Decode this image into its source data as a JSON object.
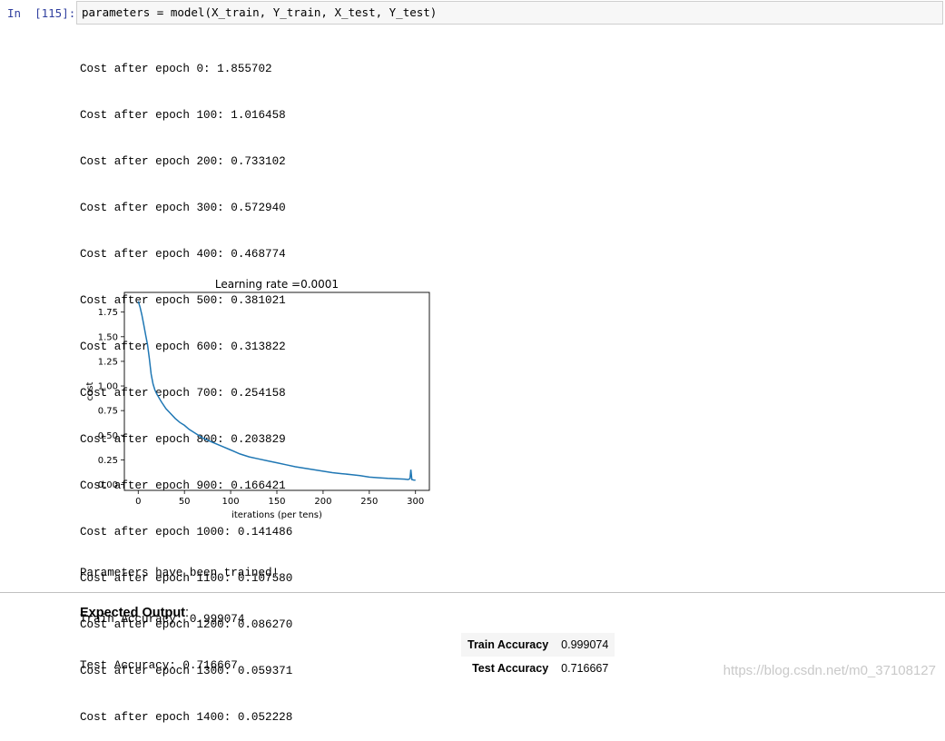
{
  "cell": {
    "prompt": "In  [115]:",
    "code": "parameters = model(X_train, Y_train, X_test, Y_test)"
  },
  "output_lines": [
    "Cost after epoch 0: 1.855702",
    "Cost after epoch 100: 1.016458",
    "Cost after epoch 200: 0.733102",
    "Cost after epoch 300: 0.572940",
    "Cost after epoch 400: 0.468774",
    "Cost after epoch 500: 0.381021",
    "Cost after epoch 600: 0.313822",
    "Cost after epoch 700: 0.254158",
    "Cost after epoch 800: 0.203829",
    "Cost after epoch 900: 0.166421",
    "Cost after epoch 1000: 0.141486",
    "Cost after epoch 1100: 0.107580",
    "Cost after epoch 1200: 0.086270",
    "Cost after epoch 1300: 0.059371",
    "Cost after epoch 1400: 0.052228"
  ],
  "chart_data": {
    "type": "line",
    "title": "Learning rate =0.0001",
    "xlabel": "iterations (per tens)",
    "ylabel": "cost",
    "xlim": [
      -15,
      315
    ],
    "ylim": [
      -0.06,
      1.95
    ],
    "xticks": [
      0,
      50,
      100,
      150,
      200,
      250,
      300
    ],
    "yticks": [
      0.0,
      0.25,
      0.5,
      0.75,
      1.0,
      1.25,
      1.5,
      1.75
    ],
    "ytick_labels": [
      "0.00",
      "0.25",
      "0.50",
      "0.75",
      "1.00",
      "1.25",
      "1.50",
      "1.75"
    ],
    "color": "#1f77b4",
    "x": [
      0,
      2,
      4,
      6,
      8,
      10,
      12,
      14,
      16,
      18,
      20,
      25,
      30,
      35,
      40,
      45,
      50,
      55,
      60,
      65,
      70,
      75,
      80,
      90,
      100,
      110,
      120,
      130,
      140,
      150,
      160,
      170,
      180,
      190,
      200,
      210,
      220,
      230,
      240,
      250,
      260,
      270,
      280,
      288,
      292,
      294,
      295,
      296,
      298,
      300
    ],
    "y": [
      1.86,
      1.8,
      1.72,
      1.62,
      1.52,
      1.42,
      1.28,
      1.12,
      1.02,
      0.96,
      0.92,
      0.84,
      0.77,
      0.72,
      0.67,
      0.63,
      0.6,
      0.56,
      0.53,
      0.5,
      0.47,
      0.45,
      0.43,
      0.39,
      0.35,
      0.31,
      0.28,
      0.26,
      0.24,
      0.22,
      0.2,
      0.18,
      0.165,
      0.15,
      0.135,
      0.12,
      0.11,
      0.1,
      0.09,
      0.075,
      0.068,
      0.062,
      0.058,
      0.054,
      0.05,
      0.06,
      0.15,
      0.05,
      0.045,
      0.043
    ]
  },
  "summary_lines": [
    "Parameters have been trained!",
    "Train Accuracy: 0.999074",
    "Test Accuracy: 0.716667"
  ],
  "expected": {
    "label": "Expected Output",
    "colon": ":",
    "rows": [
      {
        "key": "Train Accuracy",
        "value": "0.999074"
      },
      {
        "key": "Test Accuracy",
        "value": "0.716667"
      }
    ]
  },
  "watermark": "https://blog.csdn.net/m0_37108127"
}
